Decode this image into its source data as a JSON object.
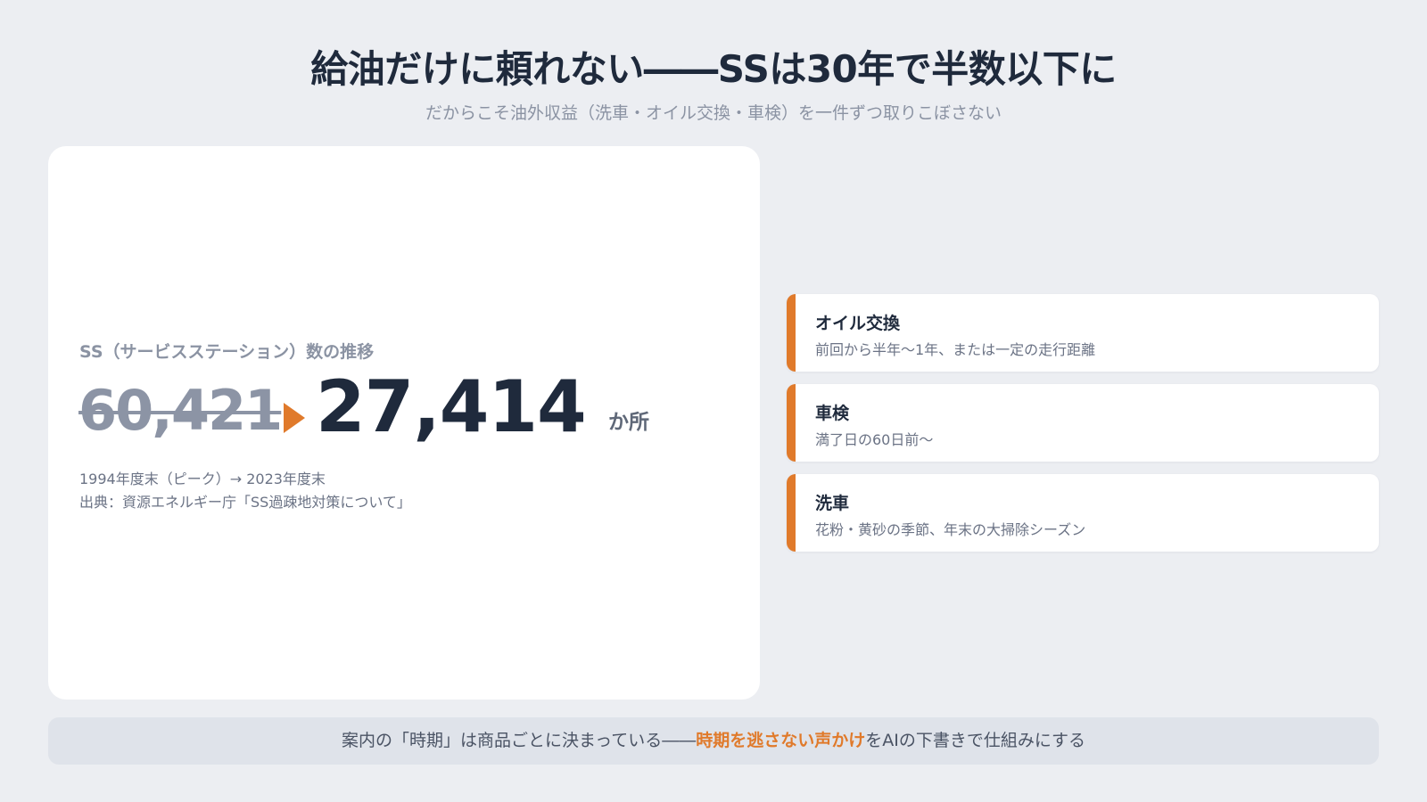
{
  "header": {
    "title": "給油だけに頼れない――SSは30年で半数以下に",
    "subtitle": "だからこそ油外収益（洗車・オイル交換・車検）を一件ずつ取りこぼさない"
  },
  "stat": {
    "label": "SS（サービスステーション）数の推移",
    "old_value": "60,421",
    "new_value": "27,414",
    "unit": "か所",
    "period": "1994年度末（ピーク）→ 2023年度末",
    "source": "出典：資源エネルギー庁「SS過疎地対策について」"
  },
  "tips": [
    {
      "title": "オイル交換",
      "desc": "前回から半年〜1年、または一定の走行距離"
    },
    {
      "title": "車検",
      "desc": "満了日の60日前〜"
    },
    {
      "title": "洗車",
      "desc": "花粉・黄砂の季節、年末の大掃除シーズン"
    }
  ],
  "banner": {
    "prefix": "案内の「時期」は商品ごとに決まっている――",
    "highlight": "時期を逃さない声かけ",
    "suffix": "をAIの下書きで仕組みにする"
  },
  "colors": {
    "accent": "#e07a2b",
    "text": "#1f2a3c",
    "muted": "#8b93a3",
    "background": "#eceef2",
    "banner": "#dfe3ea"
  },
  "icons": {
    "arrow": "triangle-right-icon"
  }
}
